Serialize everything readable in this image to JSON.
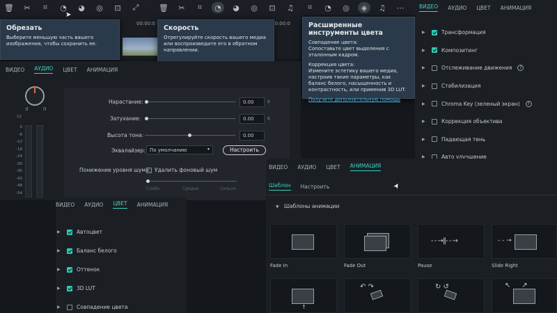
{
  "toolbar_icons": [
    "trash",
    "scissors",
    "crop",
    "speed",
    "color",
    "motion",
    "stabilize",
    "fullscreen",
    "audio",
    "more"
  ],
  "tooltips": {
    "crop": {
      "title": "Обрезать",
      "desc": "Выберите меньшую часть вашего изображения, чтобы сохранить ее."
    },
    "speed": {
      "title": "Скорость",
      "desc": "Отрегулируйте скорость вашего медиа или воспроизведите его в обратном направлении."
    },
    "color": {
      "title": "Расширенные инструменты цвета",
      "desc1": "Совпадение цвета:\nСопоставьте цвет выделения с эталонным кадром.",
      "desc2": "Коррекция цвета:\nИзмените эстетику вашего медиа, настроив такие параметры, как баланс белого, насыщенность и контрастность, или применив 3D LUT.",
      "link": "Получите дополнительную помощь"
    }
  },
  "timeline": {
    "time1": "00:00:0",
    "time2": "00:00:0"
  },
  "audio_panel": {
    "tabs": [
      "ВИДЕО",
      "АУДИО",
      "ЦВЕТ",
      "АНИМАЦИЯ"
    ],
    "active_tab": "АУДИО",
    "pan_l": "Л",
    "pan_r": "П",
    "meter_labels": [
      "0",
      "-6",
      "-12",
      "-18",
      "-24",
      "-30",
      "-36",
      "-42",
      "-48",
      "-54"
    ],
    "meter_top": "12",
    "fade_in_label": "Нарастание:",
    "fade_in_value": "0.00",
    "fade_in_unit": "s",
    "fade_out_label": "Затухание:",
    "fade_out_value": "0.00",
    "fade_out_unit": "s",
    "pitch_label": "Высота тона:",
    "pitch_value": "0.00",
    "eq_label": "Эквалайзер:",
    "eq_value": "По умолчанию",
    "eq_button": "Настроить",
    "noise_label": "Понижение уровня шума:",
    "noise_check": "Удалить фоновый шум",
    "noise_levels": [
      "Слабо",
      "Средне",
      "Сильно"
    ]
  },
  "video_panel": {
    "tabs": [
      "ВИДЕО",
      "АУДИО",
      "ЦВЕТ",
      "АНИМАЦИЯ"
    ],
    "active_tab": "ВИДЕО",
    "items": [
      {
        "label": "Трансформация",
        "checked": true
      },
      {
        "label": "Композитинг",
        "checked": true
      },
      {
        "label": "Отслеживание движения",
        "checked": false,
        "help": "?"
      },
      {
        "label": "Стабилизация",
        "checked": false
      },
      {
        "label": "Chroma Key (зеленый экран)",
        "checked": false,
        "help": "?"
      },
      {
        "label": "Коррекция объектива",
        "checked": false
      },
      {
        "label": "Падающая тень",
        "checked": false
      },
      {
        "label": "Авто улучшение",
        "checked": false
      }
    ]
  },
  "color_panel": {
    "tabs": [
      "ВИДЕО",
      "АУДИО",
      "ЦВЕТ",
      "АНИМАЦИЯ"
    ],
    "active_tab": "ЦВЕТ",
    "items": [
      {
        "label": "Автоцвет",
        "checked": true
      },
      {
        "label": "Баланс белого",
        "checked": true
      },
      {
        "label": "Оттенок",
        "checked": true
      },
      {
        "label": "3D LUT",
        "checked": true
      },
      {
        "label": "Совпадение цвета",
        "checked": false
      }
    ]
  },
  "anim_panel": {
    "tabs": [
      "ВИДЕО",
      "АУДИО",
      "ЦВЕТ",
      "АНИМАЦИЯ"
    ],
    "active_tab": "АНИМАЦИЯ",
    "subtabs": [
      "Шаблон",
      "Настроить"
    ],
    "active_subtab": "Шаблон",
    "section": "Шаблоны анимации",
    "tiles": [
      "Fade In",
      "Fade Out",
      "Pause",
      "Slide Right"
    ]
  },
  "accent": "#3fd0c1"
}
